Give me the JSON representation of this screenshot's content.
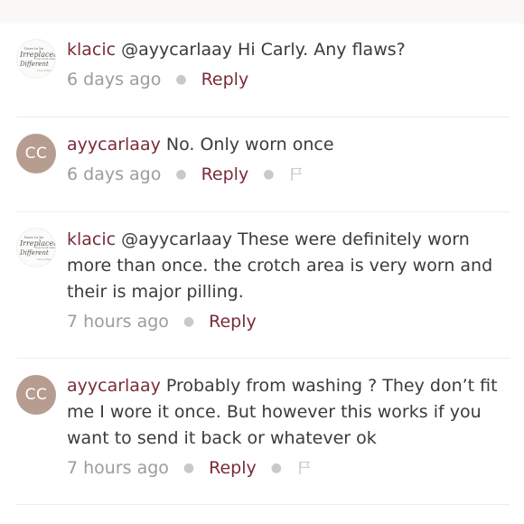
{
  "comments": [
    {
      "avatar_type": "logo",
      "avatar_icon": "script-logo-avatar",
      "username": "klacic",
      "text": "@ayycarlaay Hi Carly. Any flaws?",
      "time": "6 days ago",
      "reply_label": "Reply",
      "has_flag": false
    },
    {
      "avatar_type": "initials",
      "avatar_initials": "CC",
      "username": "ayycarlaay",
      "text": "No. Only worn once",
      "time": "6 days ago",
      "reply_label": "Reply",
      "has_flag": true
    },
    {
      "avatar_type": "logo",
      "avatar_icon": "script-logo-avatar",
      "username": "klacic",
      "text": "@ayycarlaay These were definitely worn more than once. the crotch area is very worn and their is major pilling.",
      "time": "7 hours ago",
      "reply_label": "Reply",
      "has_flag": false
    },
    {
      "avatar_type": "initials",
      "avatar_initials": "CC",
      "username": "ayycarlaay",
      "text": "Probably from washing ? They don’t fit me I wore it once. But however this works if you want to send it back or whatever ok",
      "time": "7 hours ago",
      "reply_label": "Reply",
      "has_flag": true
    }
  ],
  "colors": {
    "username": "#7a2b39",
    "reply": "#7a2b39",
    "avatar_initials_bg": "#b79c90",
    "meta_text": "#9c9c9c",
    "body_text": "#3b3b3b"
  }
}
